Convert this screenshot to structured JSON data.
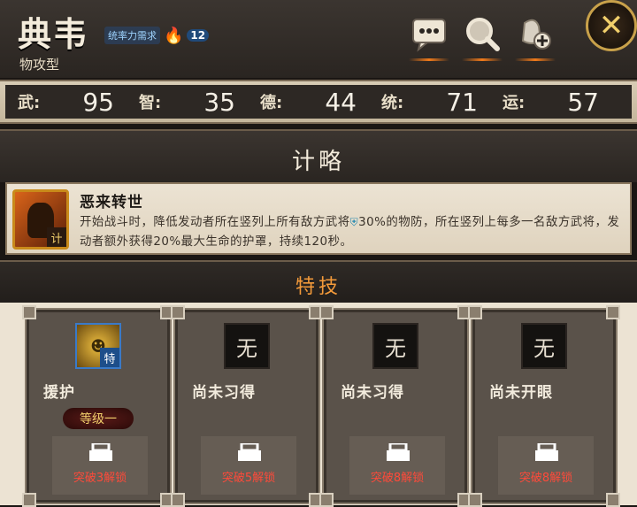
{
  "hero": {
    "name": "典韦",
    "type": "物攻型",
    "rank_text": "统率力需求",
    "rank_level": "12"
  },
  "header_buttons": [
    {
      "name": "chat-icon"
    },
    {
      "name": "search-icon"
    },
    {
      "name": "add-item-icon"
    }
  ],
  "close_label": "✕",
  "stats": [
    {
      "label": "武:",
      "value": "95"
    },
    {
      "label": "智:",
      "value": "35"
    },
    {
      "label": "德:",
      "value": "44"
    },
    {
      "label": "统:",
      "value": "71"
    },
    {
      "label": "运:",
      "value": "57"
    }
  ],
  "strategy": {
    "title": "计略",
    "skill_name": "恶来转世",
    "skill_tag": "计",
    "desc_part1": "开始战斗时，降低发动者所在竖列上所有敌方武将",
    "desc_part2": "30%的物防，所在竖列上每多一名敌方武将，发动者额外获得20%最大生命的护罩，持续120秒。"
  },
  "specialty": {
    "title": "特技",
    "cards": [
      {
        "name": "援护",
        "slot_glyph": "",
        "slot_tag": "特",
        "active": true,
        "level": "等级一",
        "lock_text": "突破3解锁"
      },
      {
        "name": "尚未习得",
        "slot_glyph": "无",
        "active": false,
        "level": "",
        "lock_text": "突破5解锁"
      },
      {
        "name": "尚未习得",
        "slot_glyph": "无",
        "active": false,
        "level": "",
        "lock_text": "突破8解锁"
      },
      {
        "name": "尚未开眼",
        "slot_glyph": "无",
        "active": false,
        "level": "",
        "lock_text": "突破8解锁"
      }
    ]
  },
  "colors": {
    "accent": "#f39a3a",
    "lock_text": "#ff4a3a",
    "panel_bg": "#ece3d3"
  }
}
